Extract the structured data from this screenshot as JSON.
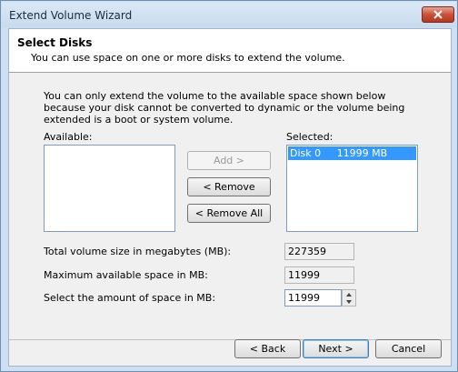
{
  "window": {
    "title": "Extend Volume Wizard"
  },
  "header": {
    "title": "Select Disks",
    "subtitle": "You can use space on one or more disks to extend the volume."
  },
  "info_text": "You can only extend the volume to the available space shown below because your disk cannot be converted to dynamic or the volume being extended is a boot or system volume.",
  "lists": {
    "available_label": "Available:",
    "selected_label": "Selected:",
    "selected_items": [
      {
        "disk": "Disk 0",
        "size": "11999 MB"
      }
    ]
  },
  "buttons": {
    "add": "Add >",
    "remove": "< Remove",
    "remove_all": "< Remove All",
    "back": "< Back",
    "next": "Next >",
    "cancel": "Cancel"
  },
  "fields": {
    "total_label": "Total volume size in megabytes (MB):",
    "total_value": "227359",
    "max_label": "Maximum available space in MB:",
    "max_value": "11999",
    "amount_label": "Select the amount of space in MB:",
    "amount_value": "11999"
  }
}
